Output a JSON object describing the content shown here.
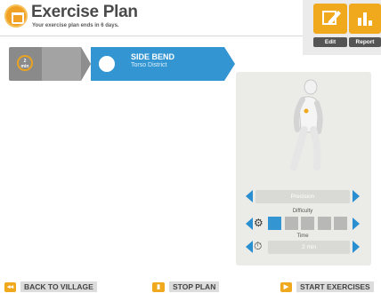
{
  "header": {
    "title": "Exercise Plan",
    "subtitle": "Your exercise plan ends in 6 days."
  },
  "toolbar": {
    "edit_label": "Edit",
    "report_label": "Report"
  },
  "timeline": {
    "first_card_time": "2",
    "first_card_unit": "min",
    "active_exercise": {
      "name": "SIDE BEND",
      "district": "Torso District"
    }
  },
  "panel": {
    "mode_label": "Precision",
    "difficulty_label": "Difficulty",
    "difficulty_level": 1,
    "difficulty_max": 5,
    "time_label": "Time",
    "time_value": "2 min"
  },
  "bottom": {
    "back_label": "BACK TO VILLAGE",
    "stop_label": "STOP PLAN",
    "start_label": "START EXERCISES"
  },
  "colors": {
    "accent_orange": "#f0a81d",
    "accent_blue": "#3396d3"
  }
}
